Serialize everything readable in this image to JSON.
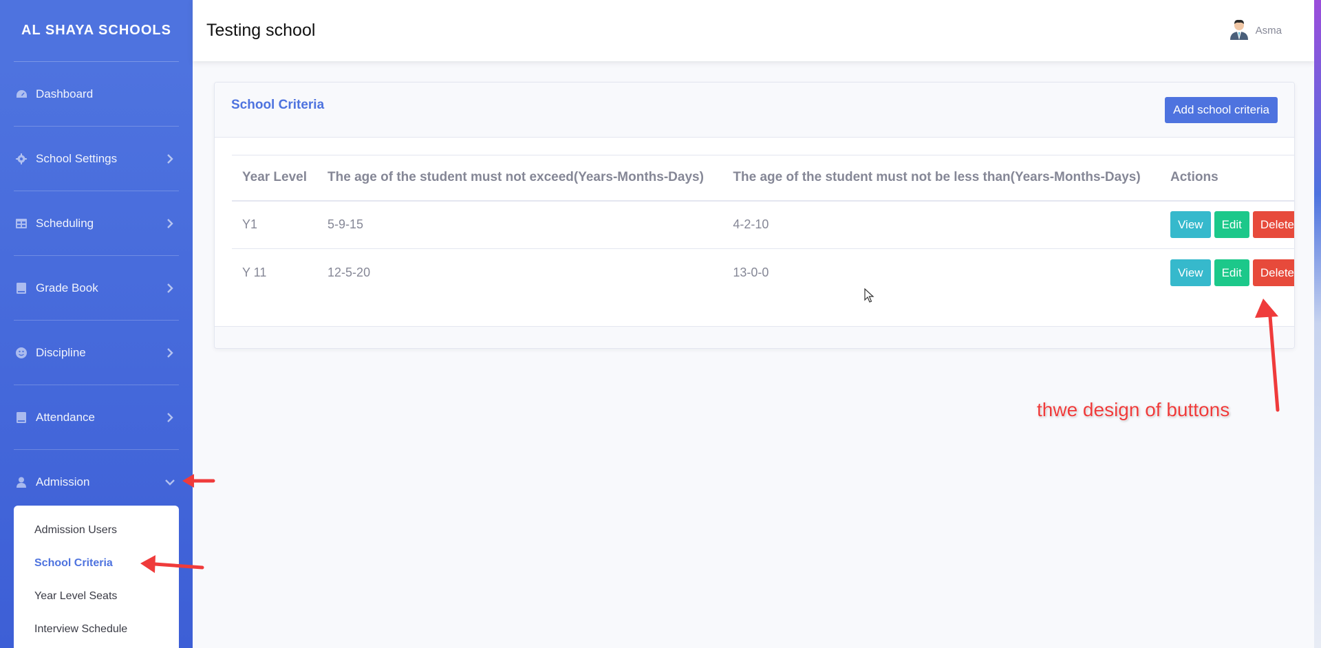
{
  "sidebar": {
    "brand": "AL SHAYA SCHOOLS",
    "items": [
      {
        "label": "Dashboard",
        "icon": "dashboard-icon"
      },
      {
        "label": "School Settings",
        "icon": "gear-icon"
      },
      {
        "label": "Scheduling",
        "icon": "table-icon"
      },
      {
        "label": "Grade Book",
        "icon": "book-icon"
      },
      {
        "label": "Discipline",
        "icon": "smiley-icon"
      },
      {
        "label": "Attendance",
        "icon": "book-icon"
      },
      {
        "label": "Admission",
        "icon": "user-icon"
      }
    ],
    "submenu": [
      {
        "label": "Admission Users"
      },
      {
        "label": "School Criteria",
        "active": true
      },
      {
        "label": "Year Level Seats"
      },
      {
        "label": "Interview Schedule"
      }
    ]
  },
  "topbar": {
    "title": "Testing school",
    "user_name": "Asma"
  },
  "card": {
    "title": "School Criteria",
    "add_button": "Add school criteria"
  },
  "table": {
    "headers": [
      "Year Level",
      "The age of the student must not exceed(Years-Months-Days)",
      "The age of the student must not be less than(Years-Months-Days)",
      "Actions"
    ],
    "rows": [
      {
        "year_level": "Y1",
        "max_age": "5-9-15",
        "min_age": "4-2-10"
      },
      {
        "year_level": "Y 11",
        "max_age": "12-5-20",
        "min_age": "13-0-0"
      }
    ],
    "actions": {
      "view": "View",
      "edit": "Edit",
      "delete": "Delete"
    }
  },
  "annotation": {
    "text": "thwe design of buttons"
  },
  "colors": {
    "primary": "#4e73df",
    "info": "#36b9cc",
    "success": "#1cc88a",
    "danger": "#e74a3b",
    "annotation": "#ef3b3b"
  }
}
